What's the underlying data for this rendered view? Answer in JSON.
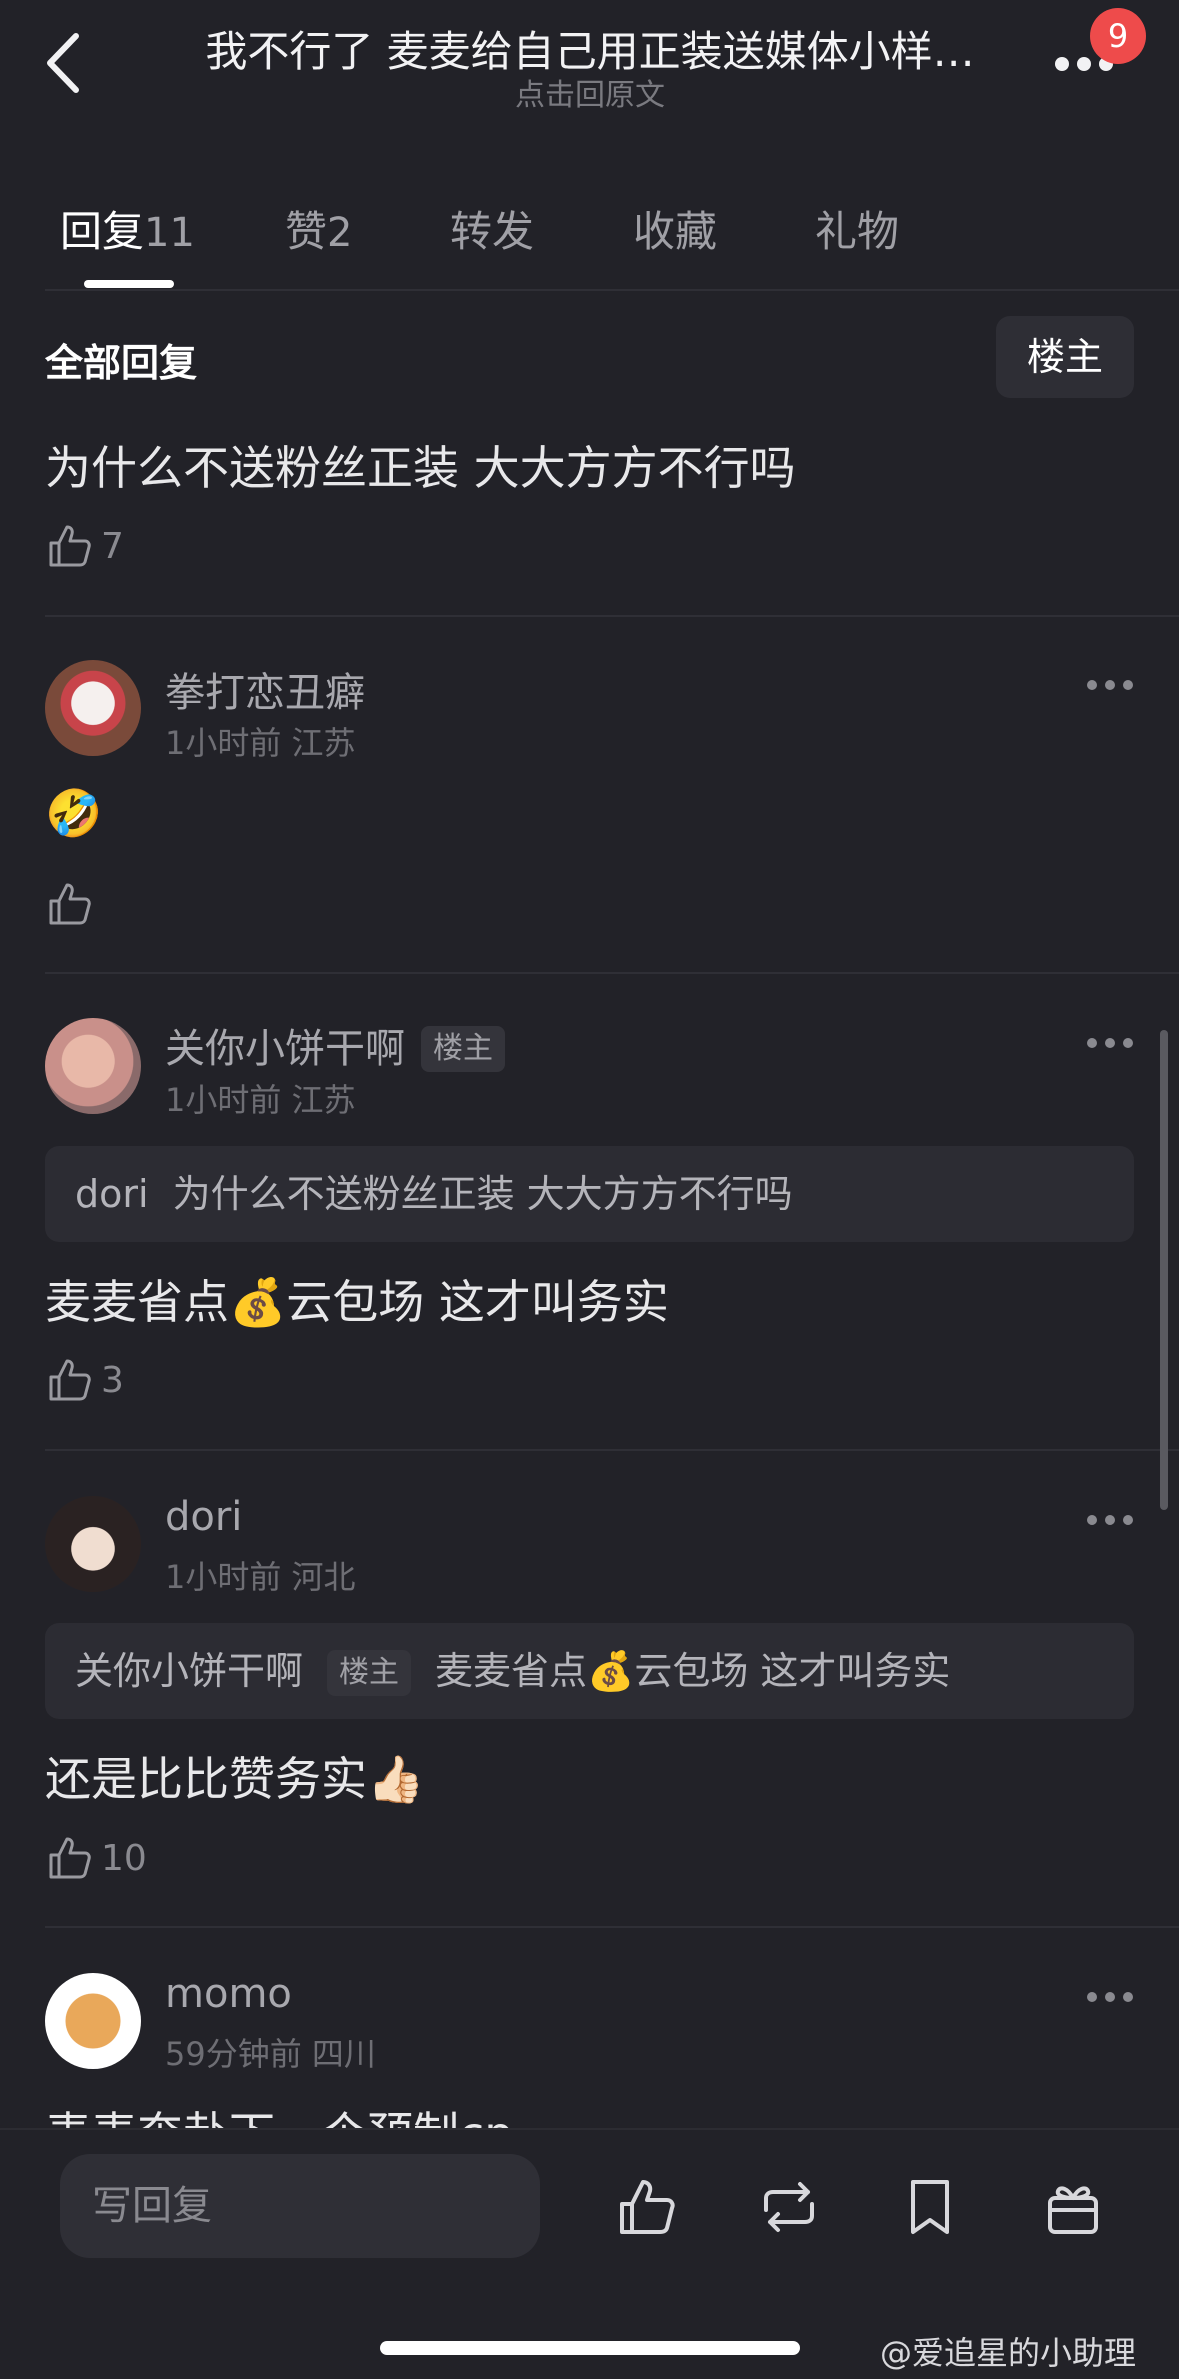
{
  "header": {
    "title": "我不行了 麦麦给自己用正装送媒体小样…",
    "subtitle": "点击回原文",
    "notification_count": "9"
  },
  "tabs": [
    {
      "label": "回复",
      "count": "11"
    },
    {
      "label": "赞",
      "count": "2"
    },
    {
      "label": "转发"
    },
    {
      "label": "收藏"
    },
    {
      "label": "礼物"
    }
  ],
  "section": {
    "title": "全部回复",
    "owner_filter": "楼主"
  },
  "root_comment": {
    "text": "为什么不送粉丝正装 大大方方不行吗",
    "likes": "7"
  },
  "comments": [
    {
      "username": "拳打恋丑癖",
      "time": "1小时前",
      "location": "江苏",
      "text": "🤣",
      "likes": ""
    },
    {
      "username": "关你小饼干啊",
      "owner_tag": "楼主",
      "time": "1小时前",
      "location": "江苏",
      "quote_name": "dori",
      "quote_text": "为什么不送粉丝正装 大大方方不行吗",
      "text": "麦麦省点💰云包场 这才叫务实",
      "likes": "3"
    },
    {
      "username": "dori",
      "time": "1小时前",
      "location": "河北",
      "quote_name": "关你小饼干啊",
      "quote_tag": "楼主",
      "quote_text": "麦麦省点💰云包场 这才叫务实",
      "text": "还是比比赞务实👍🏻",
      "likes": "10"
    },
    {
      "username": "momo",
      "time": "59分钟前",
      "location": "四川",
      "text": "麦麦奔赴下一个预制cp"
    }
  ],
  "bottom_bar": {
    "reply_placeholder": "写回复"
  },
  "watermark": "@爱追星的小助理",
  "colors": {
    "background": "#222228",
    "badge": "#ee4b4b",
    "text_primary": "#e8e8ea",
    "text_secondary": "#a8a8ae"
  }
}
